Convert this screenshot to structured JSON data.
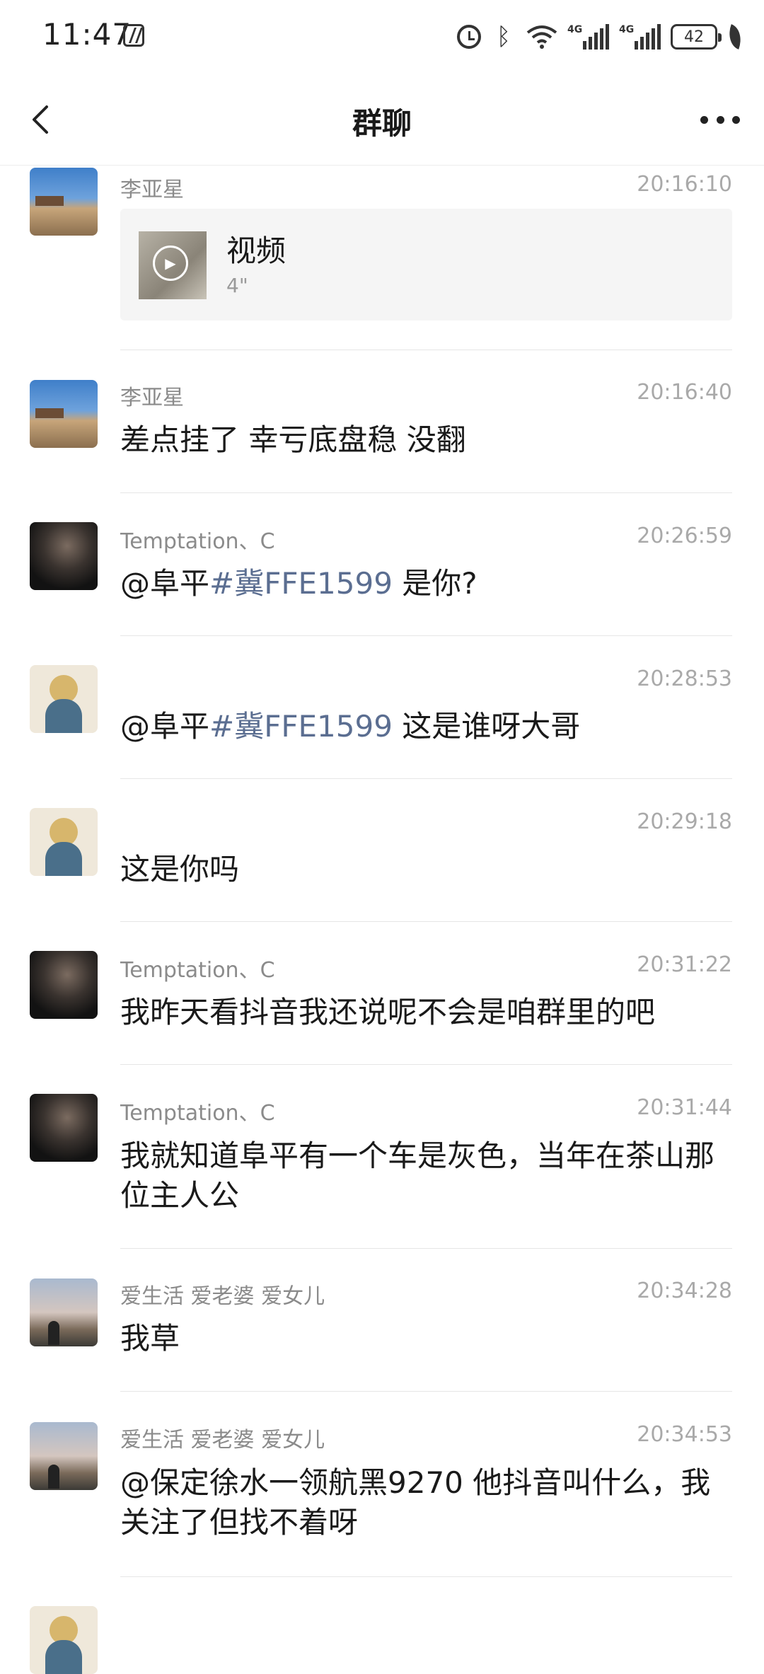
{
  "status_bar": {
    "time": "11:47",
    "net1": "4G",
    "net2": "4G",
    "battery": "42"
  },
  "nav": {
    "title": "群聊"
  },
  "messages": [
    {
      "sender": "李亚星",
      "time": "20:16:10",
      "type": "video",
      "video_title": "视频",
      "video_duration": "4\""
    },
    {
      "sender": "李亚星",
      "time": "20:16:40",
      "text": "差点挂了 幸亏底盘稳 没翻"
    },
    {
      "sender": "Temptation、C",
      "time": "20:26:59",
      "mention": "@阜平",
      "tag": "#冀FFE1599",
      "text_after": " 是你?"
    },
    {
      "sender": "",
      "time": "20:28:53",
      "mention": "@阜平",
      "tag": "#冀FFE1599",
      "text_after": " 这是谁呀大哥"
    },
    {
      "sender": "",
      "time": "20:29:18",
      "text": "这是你吗"
    },
    {
      "sender": "Temptation、C",
      "time": "20:31:22",
      "text": "我昨天看抖音我还说呢不会是咱群里的吧"
    },
    {
      "sender": "Temptation、C",
      "time": "20:31:44",
      "text": "我就知道阜平有一个车是灰色，当年在茶山那位主人公"
    },
    {
      "sender": "爱生活 爱老婆  爱女儿",
      "time": "20:34:28",
      "text": "我草"
    },
    {
      "sender": "爱生活 爱老婆  爱女儿",
      "time": "20:34:53",
      "text": "@保定徐水一领航黑9270 他抖音叫什么，我关注了但找不着呀"
    }
  ]
}
